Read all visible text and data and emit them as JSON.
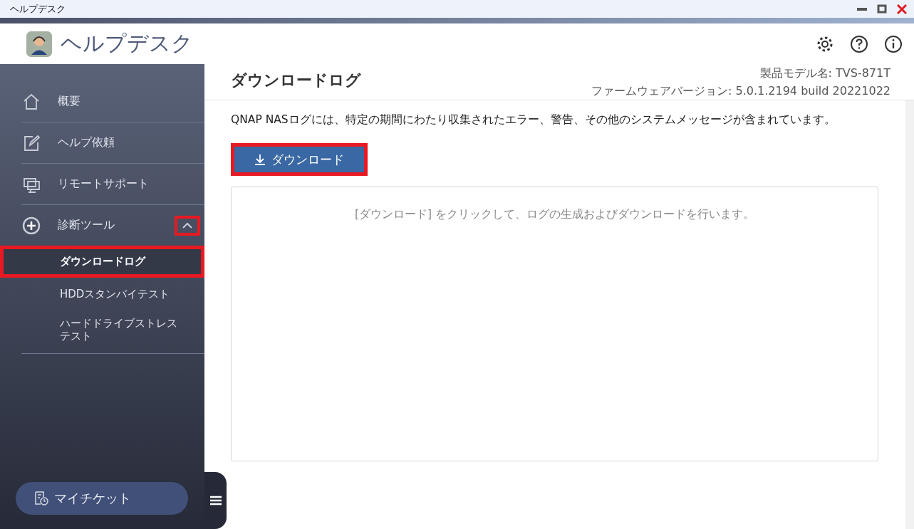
{
  "window": {
    "title": "ヘルプデスク"
  },
  "app": {
    "title": "ヘルプデスク"
  },
  "sidebar": {
    "items": [
      {
        "label": "概要"
      },
      {
        "label": "ヘルプ依頼"
      },
      {
        "label": "リモートサポート"
      },
      {
        "label": "診断ツール",
        "expanded": true,
        "toggle_highlighted": true,
        "children": [
          {
            "label": "ダウンロードログ",
            "selected": true,
            "highlighted": true
          },
          {
            "label": "HDDスタンバイテスト",
            "selected": false,
            "highlighted": false
          },
          {
            "label": "ハードドライブストレステスト",
            "selected": false,
            "highlighted": false
          }
        ]
      }
    ],
    "my_ticket": "マイチケット"
  },
  "page": {
    "title": "ダウンロードログ",
    "model": "製品モデル名: TVS-871T",
    "firmware": "ファームウェアバージョン: 5.0.1.2194 build 20221022",
    "description": "QNAP NASログには、特定の期間にわたり収集されたエラー、警告、その他のシステムメッセージが含まれています。",
    "download_button": {
      "label": "ダウンロード",
      "highlighted": true
    },
    "hint": "[ダウンロード] をクリックして、ログの生成およびダウンロードを行います。"
  }
}
